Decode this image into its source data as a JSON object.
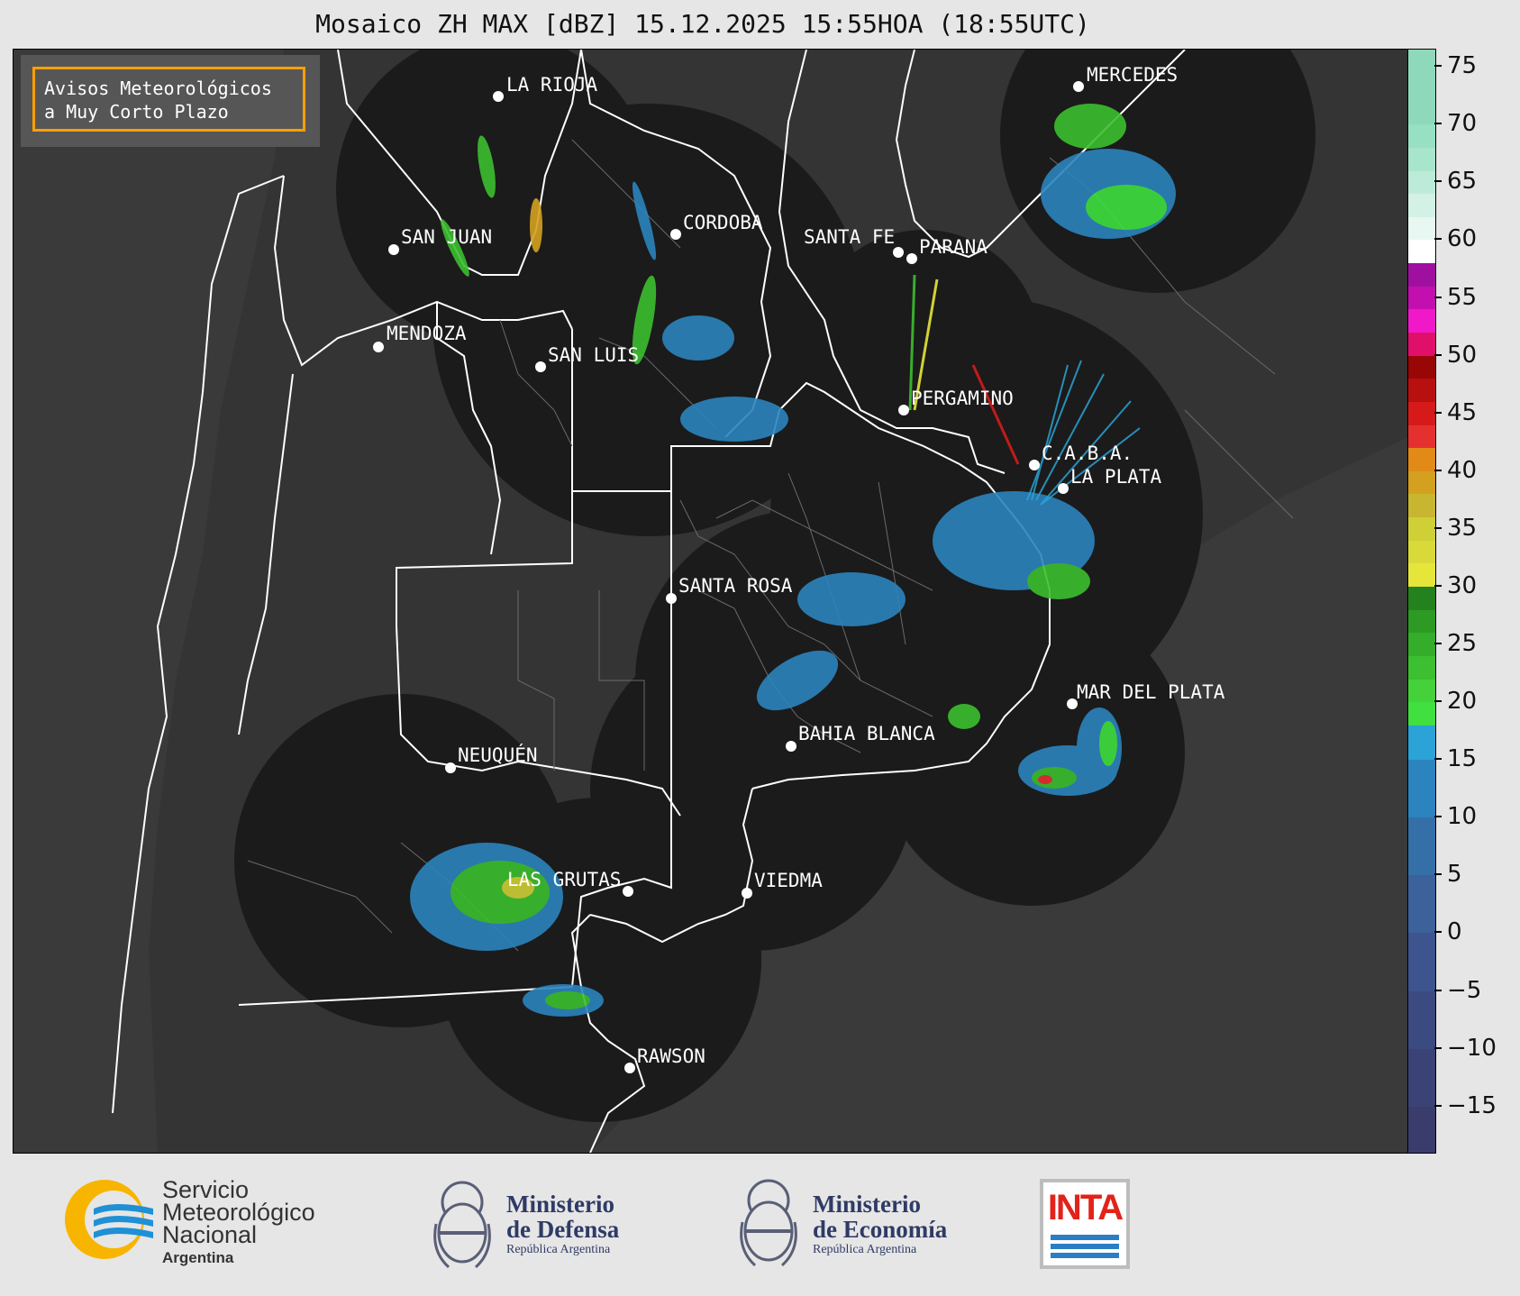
{
  "title": "Mosaico ZH MAX [dBZ] 15.12.2025 15:55HOA (18:55UTC)",
  "notice": {
    "line1": "Avisos Meteorológicos",
    "line2": "a Muy Corto Plazo"
  },
  "cities": [
    {
      "name": "LA RIOJA",
      "id": "la-rioja"
    },
    {
      "name": "MERCEDES",
      "id": "mercedes"
    },
    {
      "name": "CORDOBA",
      "id": "cordoba"
    },
    {
      "name": "SAN JUAN",
      "id": "san-juan"
    },
    {
      "name": "SANTA FE",
      "id": "santa-fe"
    },
    {
      "name": "PARANA",
      "id": "parana"
    },
    {
      "name": "MENDOZA",
      "id": "mendoza"
    },
    {
      "name": "SAN LUIS",
      "id": "san-luis"
    },
    {
      "name": "PERGAMINO",
      "id": "pergamino"
    },
    {
      "name": "C.A.B.A.",
      "id": "caba"
    },
    {
      "name": "LA PLATA",
      "id": "la-plata"
    },
    {
      "name": "SANTA ROSA",
      "id": "santa-rosa"
    },
    {
      "name": "MAR DEL PLATA",
      "id": "mar-del-plata"
    },
    {
      "name": "BAHIA BLANCA",
      "id": "bahia-blanca"
    },
    {
      "name": "NEUQUÉN",
      "id": "neuquen"
    },
    {
      "name": "LAS GRUTAS",
      "id": "las-grutas"
    },
    {
      "name": "VIEDMA",
      "id": "viedma"
    },
    {
      "name": "RAWSON",
      "id": "rawson"
    }
  ],
  "colorbar": {
    "ticks": [
      "75",
      "70",
      "65",
      "60",
      "55",
      "50",
      "45",
      "40",
      "35",
      "30",
      "25",
      "20",
      "15",
      "10",
      "5",
      "0",
      "−5",
      "−10",
      "−15"
    ],
    "min": -19,
    "max": 76.5,
    "segments": [
      {
        "from": -19,
        "to": -15,
        "color": "#3a3d6b"
      },
      {
        "from": -15,
        "to": -10,
        "color": "#3b4276"
      },
      {
        "from": -10,
        "to": -5,
        "color": "#3c4a82"
      },
      {
        "from": -5,
        "to": 0,
        "color": "#3d548e"
      },
      {
        "from": 0,
        "to": 5,
        "color": "#3c619b"
      },
      {
        "from": 5,
        "to": 10,
        "color": "#356fa8"
      },
      {
        "from": 10,
        "to": 15,
        "color": "#2b84bd"
      },
      {
        "from": 15,
        "to": 18,
        "color": "#2ba3d6"
      },
      {
        "from": 18,
        "to": 20,
        "color": "#3fe040"
      },
      {
        "from": 20,
        "to": 22,
        "color": "#45d13a"
      },
      {
        "from": 22,
        "to": 24,
        "color": "#3cbf30"
      },
      {
        "from": 24,
        "to": 26,
        "color": "#34ad2a"
      },
      {
        "from": 26,
        "to": 28,
        "color": "#2d9a24"
      },
      {
        "from": 28,
        "to": 30,
        "color": "#24821e"
      },
      {
        "from": 30,
        "to": 32,
        "color": "#e6e63a"
      },
      {
        "from": 32,
        "to": 34,
        "color": "#d9d93a"
      },
      {
        "from": 34,
        "to": 36,
        "color": "#cfcf36"
      },
      {
        "from": 36,
        "to": 38,
        "color": "#c9b630"
      },
      {
        "from": 38,
        "to": 40,
        "color": "#d4a020"
      },
      {
        "from": 40,
        "to": 42,
        "color": "#e28a18"
      },
      {
        "from": 42,
        "to": 44,
        "color": "#e53030"
      },
      {
        "from": 44,
        "to": 46,
        "color": "#d61a1a"
      },
      {
        "from": 46,
        "to": 48,
        "color": "#b80f0f"
      },
      {
        "from": 48,
        "to": 50,
        "color": "#990606"
      },
      {
        "from": 50,
        "to": 52,
        "color": "#e0106a"
      },
      {
        "from": 52,
        "to": 54,
        "color": "#f018c8"
      },
      {
        "from": 54,
        "to": 56,
        "color": "#c40fb0"
      },
      {
        "from": 56,
        "to": 58,
        "color": "#a010a0"
      },
      {
        "from": 58,
        "to": 60,
        "color": "#ffffff"
      },
      {
        "from": 60,
        "to": 62,
        "color": "#e8f7f1"
      },
      {
        "from": 62,
        "to": 64,
        "color": "#d4f1e6"
      },
      {
        "from": 64,
        "to": 66,
        "color": "#bdebd9"
      },
      {
        "from": 66,
        "to": 68,
        "color": "#a8e5cd"
      },
      {
        "from": 68,
        "to": 70,
        "color": "#98e0c3"
      },
      {
        "from": 70,
        "to": 76.5,
        "color": "#8ed9bb"
      }
    ]
  },
  "logos": {
    "smn": {
      "line1": "Servicio",
      "line2": "Meteorológico",
      "line3": "Nacional",
      "line4": "Argentina"
    },
    "defensa": {
      "line1": "Ministerio",
      "line2": "de Defensa",
      "line3": "República Argentina"
    },
    "economia": {
      "line1": "Ministerio",
      "line2": "de Economía",
      "line3": "República Argentina"
    },
    "inta": {
      "text": "INTA"
    }
  },
  "colors": {
    "map_background": "#333333",
    "radar_coverage": "#1b1b1b",
    "province_border": "#ffffff",
    "notice_border": "#ff9f00"
  }
}
